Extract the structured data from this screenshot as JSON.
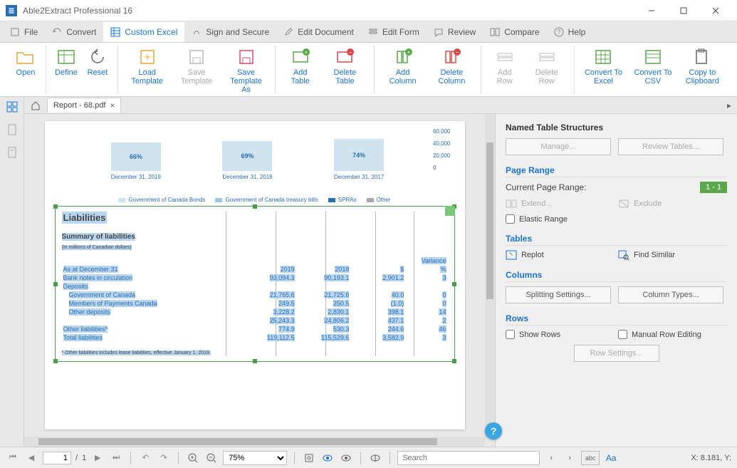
{
  "app": {
    "title": "Able2Extract Professional 16"
  },
  "menu": {
    "file": "File",
    "convert": "Convert",
    "custom_excel": "Custom Excel",
    "sign": "Sign and Secure",
    "edit_doc": "Edit Document",
    "edit_form": "Edit Form",
    "review": "Review",
    "compare": "Compare",
    "help": "Help"
  },
  "ribbon": {
    "open": "Open",
    "define": "Define",
    "reset": "Reset",
    "load_template": "Load Template",
    "save_template": "Save Template",
    "save_template_as": "Save Template As",
    "add_table": "Add Table",
    "delete_table": "Delete Table",
    "add_column": "Add Column",
    "delete_column": "Delete Column",
    "add_row": "Add Row",
    "delete_row": "Delete Row",
    "convert_excel": "Convert To Excel",
    "convert_csv": "Convert To CSV",
    "copy_clip": "Copy to Clipboard"
  },
  "tabs": {
    "doc_name": "Report - 68.pdf"
  },
  "chart_data": {
    "type": "bar",
    "title": "",
    "categories": [
      "December 31, 2019",
      "December 31, 2018",
      "December 31, 2017"
    ],
    "values_labels": [
      "66%",
      "69%",
      "74%"
    ],
    "y_ticks": [
      "60,000",
      "40,000",
      "20,000",
      "0"
    ],
    "legend": [
      "Government of Canada Bonds",
      "Government of Canada treasury bills",
      "SPRAs",
      "Other"
    ],
    "legend_colors": [
      "#cfe4ef",
      "#9cc8e3",
      "#2a6db8",
      "#a8a8a8"
    ]
  },
  "doc": {
    "section_title": "Liabilities",
    "subtitle": "Summary of liabilities",
    "subtitle_note": "(In millions of Canadian dollars)",
    "variance": "Variance",
    "percent": "%",
    "header_asat": "As at December 31",
    "header_y1": "2019",
    "header_y2": "2018",
    "header_s": "$",
    "rows": {
      "bank_notes": "Bank notes in circulation",
      "bank_notes_v": [
        "93,094.3",
        "90,193.1",
        "2,901.2",
        "3"
      ],
      "deposits": "Deposits",
      "goc": "Government of Canada",
      "goc_v": [
        "21,765.6",
        "21,725.6",
        "40.0",
        "0"
      ],
      "mpc": "Members of Payments Canada",
      "mpc_v": [
        "249.5",
        "250.5",
        "(1.0)",
        "0"
      ],
      "other_dep": "Other deposits",
      "other_dep_v": [
        "3,228.2",
        "2,830.1",
        "398.1",
        "14"
      ],
      "subtotal_v": [
        "25,243.3",
        "24,806.2",
        "437.1",
        "2"
      ],
      "other_liab": "Other liabilities*",
      "other_liab_v": [
        "774.9",
        "530.3",
        "244.6",
        "46"
      ],
      "total": "Total liabilities",
      "total_v": [
        "119,112.5",
        "115,529.6",
        "3,582.9",
        "3"
      ],
      "footnote": "* Other liabilities includes lease liabilities, effective January 1, 2019."
    }
  },
  "panel": {
    "title": "Named Table Structures",
    "manage": "Manage...",
    "review_tables": "Review Tables...",
    "page_range": "Page Range",
    "current_range_label": "Current Page Range:",
    "current_range_value": "1 - 1",
    "extend": "Extend...",
    "exclude": "Exclude",
    "elastic_range": "Elastic Range",
    "tables": "Tables",
    "replot": "Replot",
    "find_similar": "Find Similar",
    "columns": "Columns",
    "splitting": "Splitting Settings...",
    "column_types": "Column Types...",
    "rows": "Rows",
    "show_rows": "Show Rows",
    "manual_row": "Manual Row Editing",
    "row_settings": "Row Settings..."
  },
  "status": {
    "page_current": "1",
    "page_total": "1",
    "zoom": "75%",
    "search_placeholder": "Search",
    "coords": "X: 8.181, Y:"
  }
}
